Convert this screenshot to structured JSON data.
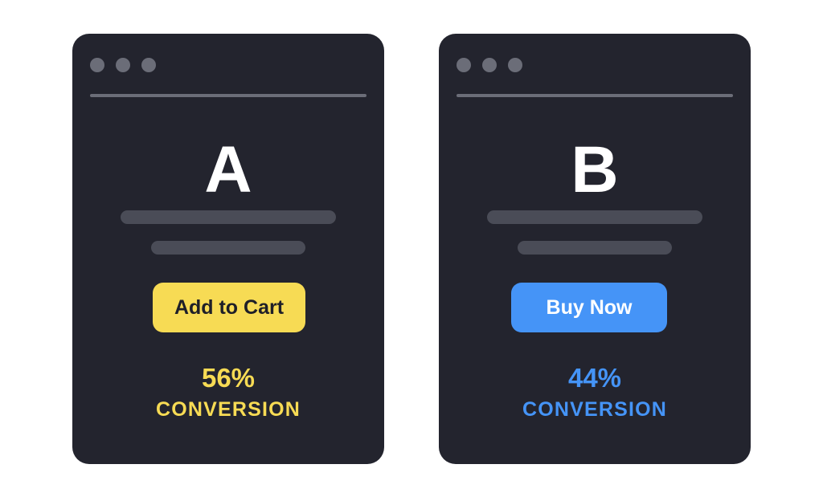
{
  "page": {
    "background_color": "#ffffff"
  },
  "theme": {
    "card_background": "#23242e",
    "dot_color": "#6b6d78",
    "divider_color": "#6b6d78",
    "skeleton_bar_color": "#4a4c57",
    "letter_color": "#ffffff",
    "accent_yellow": "#f7db54",
    "accent_blue": "#4594f7"
  },
  "variants": [
    {
      "id": "a",
      "letter": "A",
      "cta_label": "Add to Cart",
      "cta_background": "#f7db54",
      "cta_text_color": "#1e1f28",
      "stat_value": "56%",
      "stat_label": "CONVERSION",
      "accent_color": "#f7db54",
      "window_dots": [
        "dot-close",
        "dot-minimize",
        "dot-maximize"
      ]
    },
    {
      "id": "b",
      "letter": "B",
      "cta_label": "Buy Now",
      "cta_background": "#4594f7",
      "cta_text_color": "#ffffff",
      "stat_value": "44%",
      "stat_label": "CONVERSION",
      "accent_color": "#4594f7",
      "window_dots": [
        "dot-close",
        "dot-minimize",
        "dot-maximize"
      ]
    }
  ]
}
